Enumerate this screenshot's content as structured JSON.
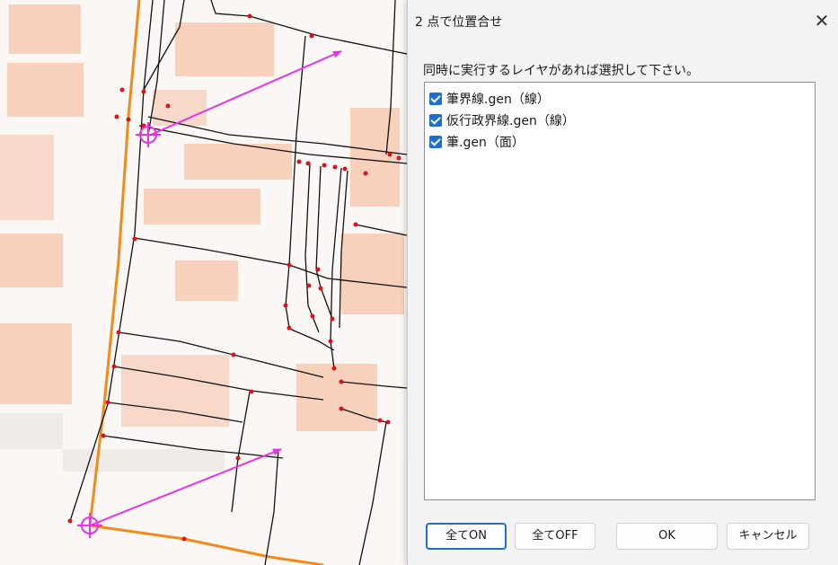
{
  "dialog": {
    "title": "2 点で位置合せ",
    "close_glyph": "✕",
    "prompt": "同時に実行するレイヤがあれば選択して下さい。",
    "layers": [
      {
        "label": "筆界線.gen（線）",
        "checked": true
      },
      {
        "label": "仮行政界線.gen（線）",
        "checked": true
      },
      {
        "label": "筆.gen（面）",
        "checked": true
      }
    ],
    "buttons": {
      "all_on": "全てON",
      "all_off": "全てOFF",
      "ok": "OK",
      "cancel": "キャンセル"
    }
  },
  "map": {
    "boundary_color": "#f28a1a",
    "line_color": "#111111",
    "vertex_color": "#d9141c",
    "arrow_color": "#e633e6",
    "building_color": "#f7c9b1",
    "icons": [
      "crosshair-target-icon",
      "crosshair-target-icon"
    ]
  }
}
